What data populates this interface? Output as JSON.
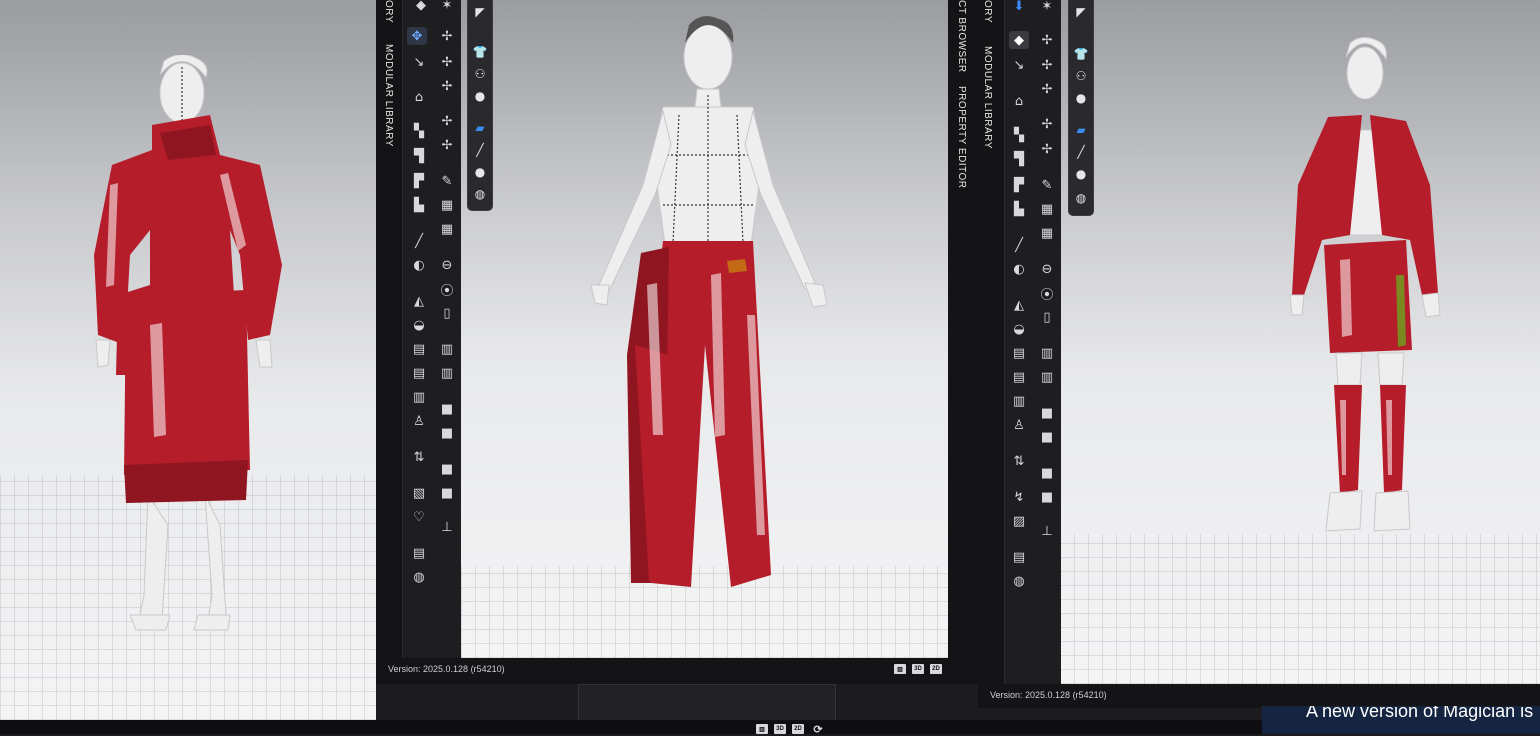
{
  "left_window": {
    "tabs": [
      "ORY",
      "MODULAR LIBRARY"
    ],
    "version": "Version: 2025.0.128 (r54210)",
    "view_icons": [
      "3D",
      "2D"
    ]
  },
  "right_window": {
    "tabs": [
      "CT BROWSER",
      "PROPERTY EDITOR",
      "ORY",
      "MODULAR LIBRARY"
    ],
    "version": "Version: 2025.0.128 (r54210)"
  },
  "notification": {
    "text": "A new version of Magician is"
  },
  "colors": {
    "garment_red": "#b51d2a",
    "toolbar_bg": "#1e1e21",
    "accent_blue": "#3d8bff",
    "notification_bg": "#152541"
  },
  "icons": {
    "toolbar": "clo-tool-icons",
    "float": [
      "shirt-icon",
      "fabric-icon",
      "avatar-icon",
      "blue-paint-icon",
      "brush-icon",
      "person-icon",
      "globe-icon"
    ]
  }
}
